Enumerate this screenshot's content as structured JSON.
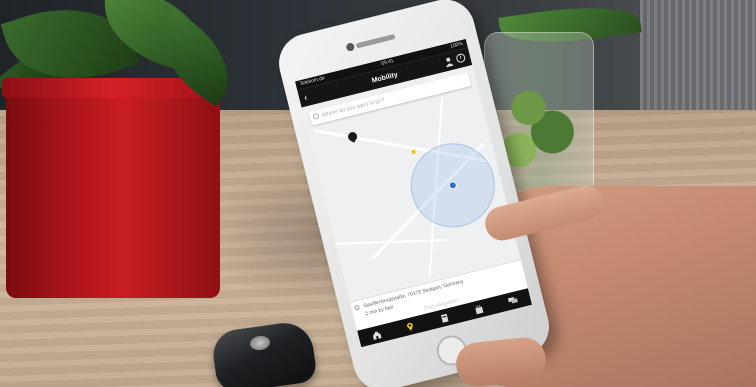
{
  "phone_app": {
    "status": {
      "carrier": "Telekom.de",
      "time": "09:41",
      "battery": "100%"
    },
    "appbar": {
      "title": "Mobility",
      "back_glyph": "‹"
    },
    "search": {
      "placeholder": "Where do you want to go?"
    },
    "location_card": {
      "address": "Stauffenbergstraße, 70173 Stuttgart, Germany",
      "distance": "2 min by foot",
      "action": "Start navigation"
    },
    "tabs": [
      {
        "icon": "home-icon"
      },
      {
        "icon": "map-pin-icon",
        "active_color": "#f2c300"
      },
      {
        "icon": "document-icon"
      },
      {
        "icon": "bag-icon"
      },
      {
        "icon": "chat-icon"
      }
    ]
  },
  "colors": {
    "accent": "#f2c300",
    "app_bar": "#151515",
    "pot_red": "#c81d22",
    "location_blue": "#2f6fd1"
  }
}
